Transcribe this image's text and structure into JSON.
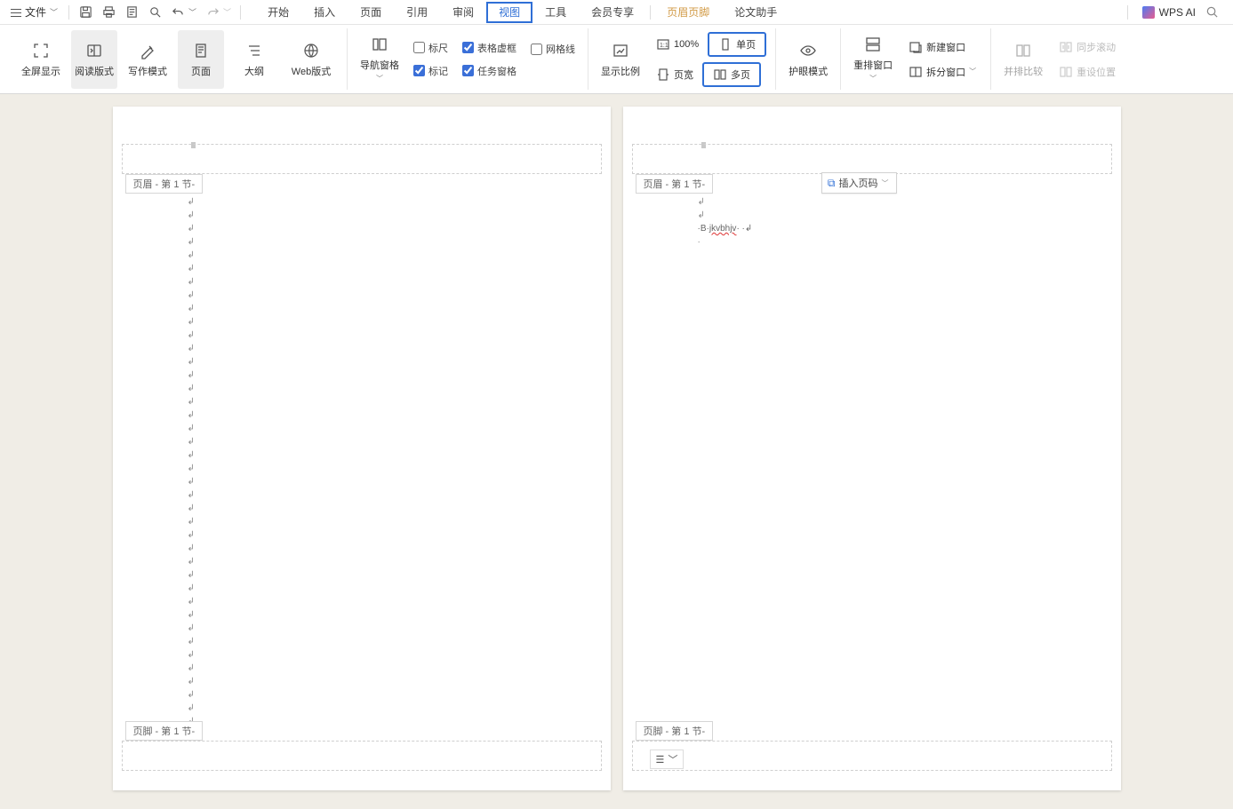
{
  "topbar": {
    "file_label": "文件"
  },
  "tabs": {
    "start": "开始",
    "insert": "插入",
    "page": "页面",
    "reference": "引用",
    "review": "审阅",
    "view": "视图",
    "tools": "工具",
    "vip": "会员专享",
    "headerfooter": "页眉页脚",
    "thesis": "论文助手"
  },
  "right": {
    "wps_ai": "WPS AI"
  },
  "ribbon": {
    "fullscreen": "全屏显示",
    "reading": "阅读版式",
    "writing": "写作模式",
    "page_view": "页面",
    "outline": "大纲",
    "web": "Web版式",
    "nav_pane": "导航窗格",
    "ruler": "标尺",
    "table_dash": "表格虚框",
    "grid": "网格线",
    "mark": "标记",
    "task_pane": "任务窗格",
    "show_ratio": "显示比例",
    "zoom100": "100%",
    "page_width": "页宽",
    "single_page": "单页",
    "multi_page": "多页",
    "eye": "护眼模式",
    "rearrange": "重排窗口",
    "new_window": "新建窗口",
    "split_window": "拆分窗口",
    "side_by_side": "并排比较",
    "sync_scroll": "同步滚动",
    "reset_pos": "重设位置"
  },
  "doc": {
    "header_label": "页眉  - 第 1 节-",
    "footer_label": "页脚  - 第 1 节-",
    "insert_page_num": "插入页码",
    "line2_prefix": "B",
    "line2_text": "jkvbhjv"
  }
}
